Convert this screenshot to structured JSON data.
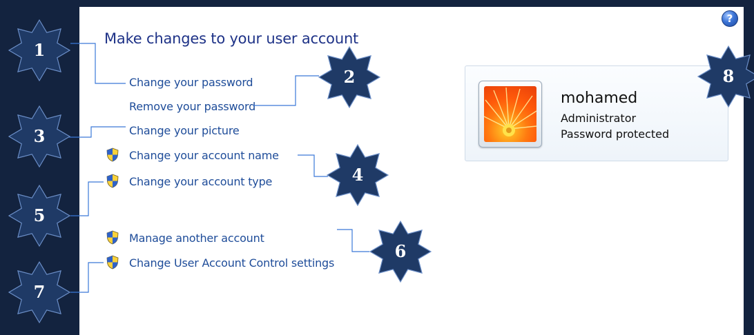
{
  "page": {
    "title": "Make changes to your user account",
    "help_icon_glyph": "?"
  },
  "links": [
    {
      "label": "Change your password",
      "shield": false
    },
    {
      "label": "Remove your password",
      "shield": false
    },
    {
      "label": "Change your picture",
      "shield": false
    },
    {
      "label": "Change your account name",
      "shield": true
    },
    {
      "label": "Change your account type",
      "shield": true
    },
    {
      "label": "Manage another account",
      "shield": true
    },
    {
      "label": "Change User Account Control settings",
      "shield": true
    }
  ],
  "account": {
    "username": "mohamed",
    "role": "Administrator",
    "status": "Password protected"
  },
  "callouts": [
    "1",
    "2",
    "3",
    "4",
    "5",
    "6",
    "7",
    "8"
  ],
  "colors": {
    "background": "#13233f",
    "link": "#1e4c99",
    "title": "#1e3287",
    "badge_fill": "#1f3a66"
  },
  "icons": {
    "help": "help-question-icon",
    "shield": "uac-shield-icon",
    "avatar": "flower-picture"
  }
}
